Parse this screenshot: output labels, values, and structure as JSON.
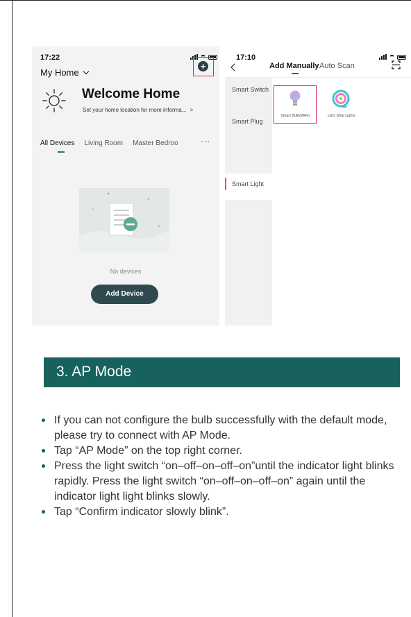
{
  "phone1": {
    "time": "17:22",
    "home_title": "My Home",
    "welcome_title": "Welcome Home",
    "location_hint": "Set your home location for more informa...",
    "location_arrow": ">",
    "add_symbol": "+",
    "tabs": [
      "All Devices",
      "Living Room",
      "Master Bedroo"
    ],
    "more_label": "···",
    "empty_text": "No devices",
    "add_device_label": "Add Device"
  },
  "phone2": {
    "time": "17:10",
    "tabs": {
      "manual": "Add Manually",
      "scan": "Auto Scan"
    },
    "categories": [
      "Smart Switch",
      "Smart Plug",
      "Smart Light"
    ],
    "products": [
      "Smart Bulb(WiFi)",
      "LED Strip Lights"
    ]
  },
  "section": {
    "title": "3. AP Mode"
  },
  "bullets": [
    "If you can not configure the bulb successfully with the default mode, please try to connect with AP Mode.",
    "Tap “AP Mode” on the top right corner.",
    "Press the light switch “on–off–on–off–on”until the indicator light blinks rapidly. Press the light switch “on–off–on–off–on” again until the indicator light light blinks slowly.",
    "Tap “Confirm indicator slowly blink”."
  ],
  "colors": {
    "accent_teal": "#17625c",
    "highlight_pink": "#e0245e",
    "button_dark": "#2e4a4f",
    "active_category_bar": "#e85a2c"
  },
  "icons": [
    "sun-icon",
    "add-circle-icon",
    "chevron-down-icon",
    "back-chevron-icon",
    "scan-icon",
    "bulb-icon",
    "led-strip-icon",
    "empty-state-illustration"
  ]
}
